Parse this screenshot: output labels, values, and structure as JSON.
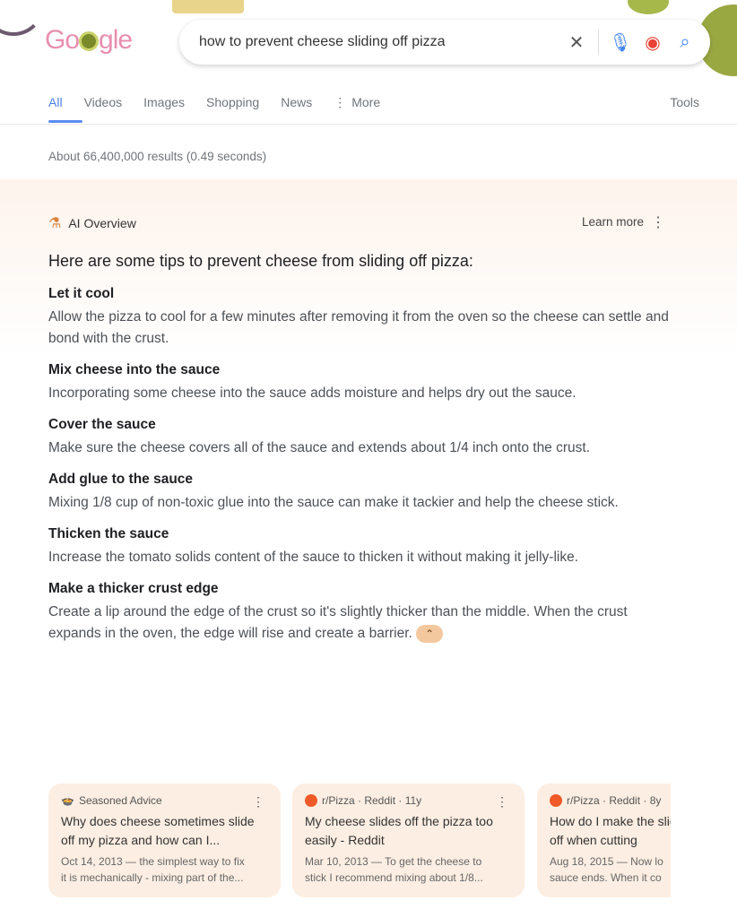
{
  "logo": {
    "text": "Google"
  },
  "search": {
    "query": "how to prevent cheese sliding off pizza",
    "icons": [
      "close-icon",
      "microphone-icon",
      "lens-icon",
      "search-icon"
    ]
  },
  "tabs": [
    "All",
    "Videos",
    "Images",
    "Shopping",
    "News",
    "More"
  ],
  "tools": "Tools",
  "stats": "About 66,400,000 results (0.49 seconds)",
  "ai": {
    "label": "AI Overview",
    "learn_more": "Learn more",
    "heading": "Here are some tips to prevent cheese from sliding off pizza:",
    "sections": [
      {
        "title": "Let it cool",
        "body": "Allow the pizza to cool for a few minutes after removing it from the oven so the cheese can settle and bond with the crust."
      },
      {
        "title": "Mix cheese into the sauce",
        "body": "Incorporating some cheese into the sauce adds moisture and helps dry out the sauce."
      },
      {
        "title": "Cover the sauce",
        "body": "Make sure the cheese covers all of the sauce and extends about 1/4 inch onto the crust."
      },
      {
        "title": "Add glue to the sauce",
        "body": "Mixing 1/8 cup of non-toxic glue into the sauce can make it tackier and help the cheese stick."
      },
      {
        "title": "Thicken the sauce",
        "body": "Increase the tomato solids content of the sauce to thicken it without making it jelly-like."
      },
      {
        "title": "Make a thicker crust edge",
        "body": "Create a lip around the edge of the crust so it's slightly thicker than the middle. When the crust expands in the oven, the edge will rise and create a barrier."
      }
    ]
  },
  "cards": [
    {
      "source": "Seasoned Advice",
      "title": "Why does cheese sometimes slide off my pizza and how can I...",
      "snippet1": "Oct 14, 2013 — the simplest way to fix",
      "snippet2": "it is mechanically - mixing part of the..."
    },
    {
      "source": "r/Pizza · Reddit · 11y",
      "title": "My cheese slides off the pizza too easily - Reddit",
      "snippet1": "Mar 10, 2013 — To get the cheese to",
      "snippet2": "stick I recommend mixing about 1/8..."
    },
    {
      "source": "r/Pizza · Reddit · 8y",
      "title": "How do I make the slide off when cutting",
      "snippet1": "Aug 18, 2015 — Now lo",
      "snippet2": "sauce ends. When it co"
    }
  ]
}
